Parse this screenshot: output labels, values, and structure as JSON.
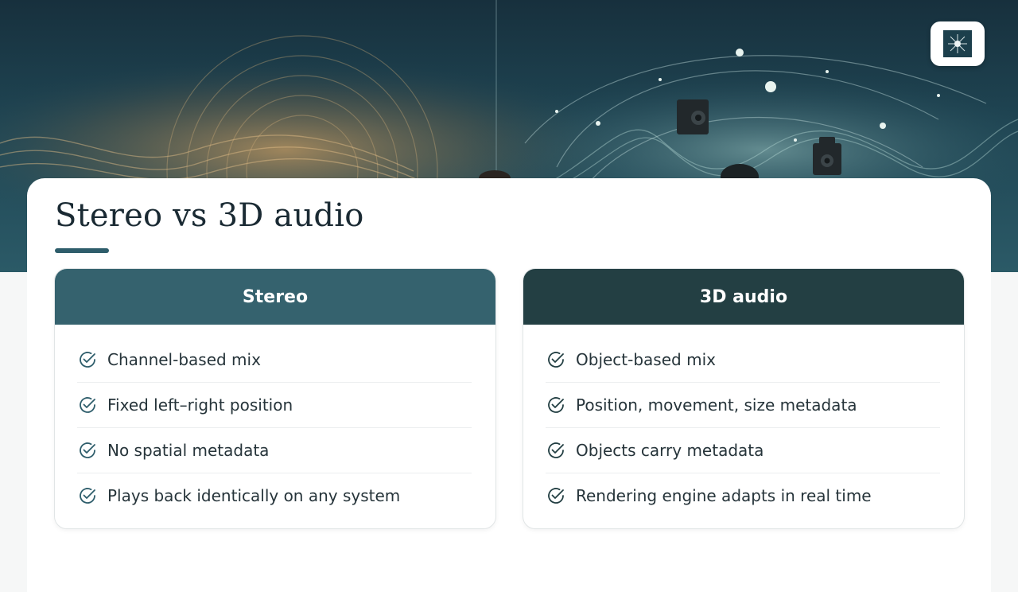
{
  "slide": {
    "title": "Stereo vs 3D audio",
    "accent_color": "#2e5d6b"
  },
  "hero": {
    "description_icon": "logo-icon"
  },
  "columns": [
    {
      "heading": "Stereo",
      "header_color": "#35626e",
      "items": [
        "Channel-based mix",
        "Fixed left–right position",
        "No spatial metadata",
        "Plays back identically on any system"
      ]
    },
    {
      "heading": "3D audio",
      "header_color": "#233f43",
      "items": [
        "Object-based mix",
        "Position, movement, size metadata",
        "Objects carry metadata",
        "Rendering engine adapts in real time"
      ]
    }
  ],
  "icons": {
    "check": "check-circle-icon",
    "logo": "logo-icon"
  }
}
